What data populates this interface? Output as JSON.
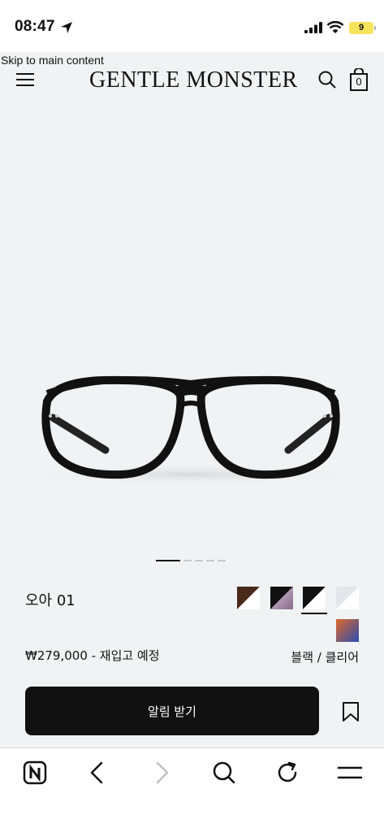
{
  "status_bar": {
    "time": "08:47",
    "battery": "9",
    "icons": [
      "location-arrow-icon",
      "signal-icon",
      "wifi-icon",
      "battery-icon"
    ]
  },
  "header": {
    "skip_link": "Skip to main content",
    "logo": "GENTLE MONSTER",
    "cart_count": "0",
    "icons": [
      "menu-icon",
      "search-icon",
      "shopping-bag-icon"
    ]
  },
  "carousel": {
    "slide_count": 5,
    "active_index": 0
  },
  "product": {
    "name": "오아 01",
    "price": "₩279,000 - 재입고 예정",
    "color": "블랙 / 클리어",
    "notify_label": "알림 받기",
    "swatches": [
      {
        "name": "brown",
        "colors": [
          "#4a2a1a",
          "#ffffff"
        ],
        "selected": false
      },
      {
        "name": "black-purple",
        "colors": [
          "#1a1a1a",
          "#b8a0c0"
        ],
        "selected": false
      },
      {
        "name": "black-clear",
        "colors": [
          "#111111",
          "#ffffff"
        ],
        "selected": true
      },
      {
        "name": "clear",
        "colors": [
          "#e6e9ec",
          "#ffffff"
        ],
        "selected": false
      },
      {
        "name": "orange-blue",
        "colors": [
          "#c04a1a",
          "#2a5ad0"
        ],
        "selected": false
      }
    ]
  },
  "browser_bar": {
    "icons": [
      "naver-home-icon",
      "back-icon",
      "forward-icon",
      "search-icon",
      "refresh-icon",
      "menu-icon"
    ]
  },
  "colors": {
    "page_background": "#f0f3f4",
    "button_background": "#111111",
    "button_text": "#ffffff",
    "battery": "#f5e35a"
  }
}
